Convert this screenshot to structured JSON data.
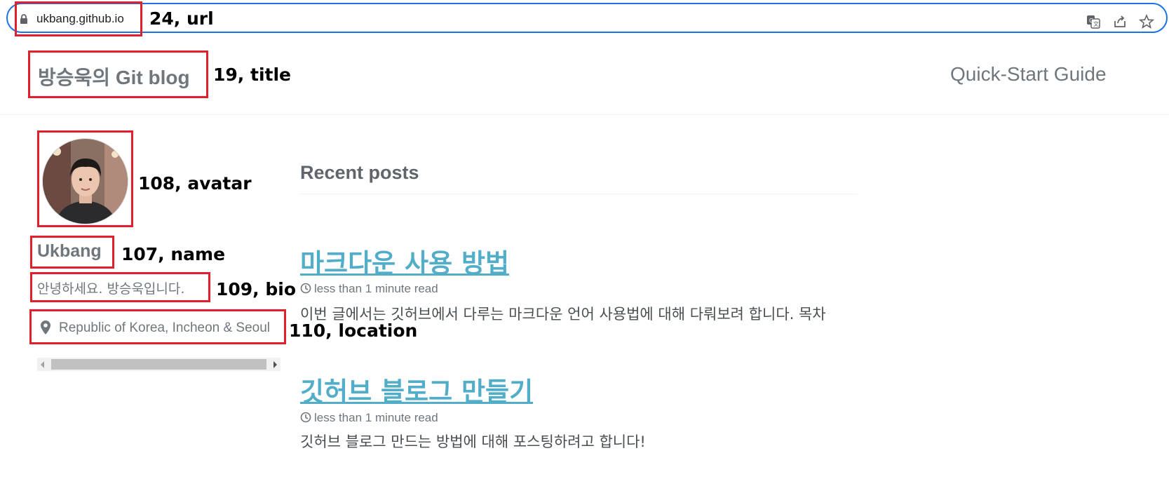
{
  "browser": {
    "url": "ukbang.github.io",
    "icons": [
      "lock-icon",
      "translate-icon",
      "share-icon",
      "bookmark-star-icon"
    ]
  },
  "annotations": {
    "url": "24, url",
    "title": "19, title",
    "avatar": "108, avatar",
    "name": "107, name",
    "bio": "109, bio",
    "location": "110, location"
  },
  "masthead": {
    "title_korean": "방승욱의",
    "title_english": "Git blog",
    "nav_link": "Quick-Start Guide"
  },
  "sidebar": {
    "name": "Ukbang",
    "bio": "안녕하세요. 방승욱입니다.",
    "location": "Republic of Korea, Incheon & Seoul",
    "location_icon": "map-marker-icon"
  },
  "main": {
    "heading": "Recent posts",
    "posts": [
      {
        "title": "마크다운 사용 방법",
        "meta": "less than 1 minute read",
        "excerpt": "이번 글에서는 깃허브에서 다루는 마크다운 언어 사용법에 대해 다뤄보려 합니다. 목차"
      },
      {
        "title": "깃허브 블로그 만들기",
        "meta": "less than 1 minute read",
        "excerpt": "깃허브 블로그 만드는 방법에 대해 포스팅하려고 합니다!"
      }
    ]
  },
  "colors": {
    "link": "#52adc8",
    "annotation_box": "#e0202a",
    "url_focus": "#1a73e8"
  }
}
